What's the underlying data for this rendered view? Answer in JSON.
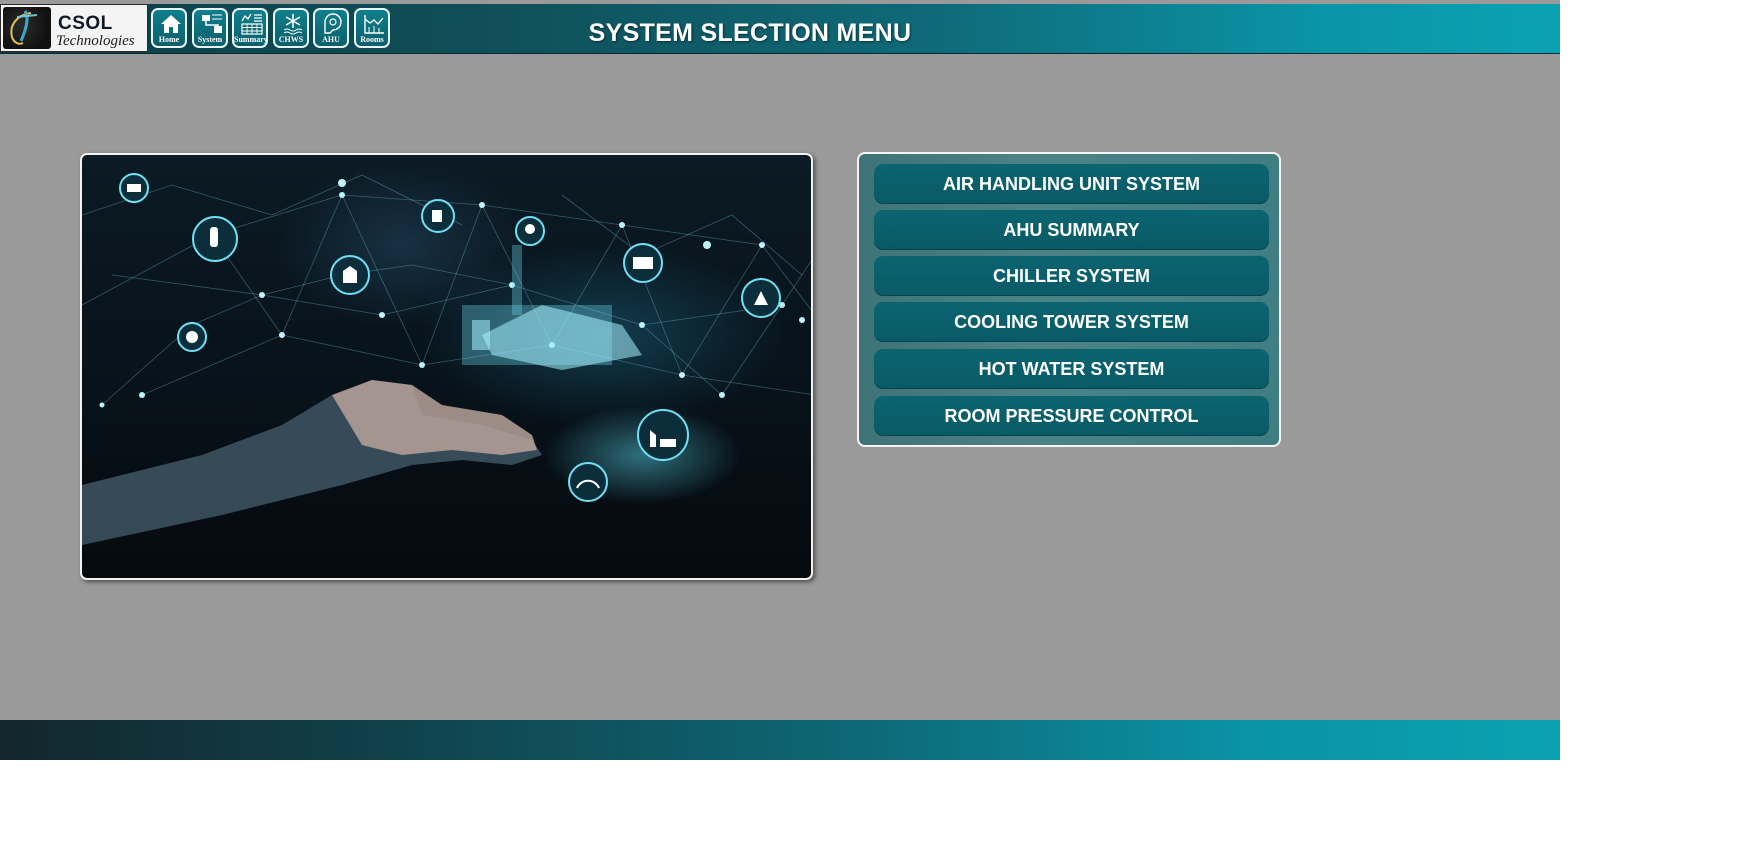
{
  "logo": {
    "name": "CSOL",
    "tagline": "Technologies"
  },
  "nav": [
    {
      "label": "Home",
      "icon": "home-icon"
    },
    {
      "label": "System",
      "icon": "system-diagram-icon"
    },
    {
      "label": "Summary",
      "icon": "summary-table-icon"
    },
    {
      "label": "CHWS",
      "icon": "snowflake-icon"
    },
    {
      "label": "AHU",
      "icon": "fan-icon"
    },
    {
      "label": "Rooms",
      "icon": "rooms-icon"
    }
  ],
  "header": {
    "title": "SYSTEM SLECTION MENU"
  },
  "hero": {
    "icon": "smart-factory-illustration"
  },
  "menu": {
    "items": [
      "AIR HANDLING UNIT SYSTEM",
      "AHU SUMMARY",
      "CHILLER SYSTEM",
      "COOLING TOWER SYSTEM",
      "HOT WATER SYSTEM",
      "ROOM PRESSURE CONTROL"
    ]
  },
  "colors": {
    "background": "#9a9a9a",
    "header_dark": "#0d3d45",
    "header_light": "#0aa2b2",
    "button": "#0a6470",
    "panel": "#4c8286"
  }
}
